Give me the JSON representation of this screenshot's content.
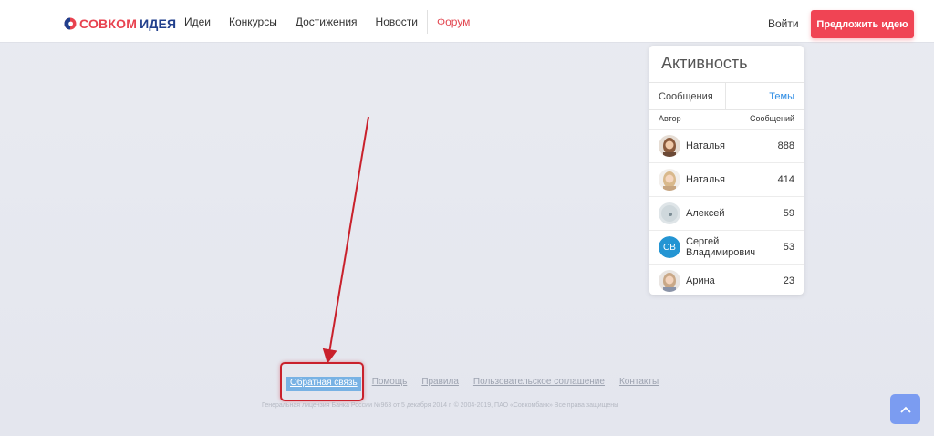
{
  "header": {
    "logo_part1": "СОВКОМ",
    "logo_part2": "ИДЕЯ",
    "nav": [
      {
        "label": "Идеи"
      },
      {
        "label": "Конкурсы"
      },
      {
        "label": "Достижения"
      },
      {
        "label": "Новости"
      },
      {
        "label": "Форум"
      }
    ],
    "login": "Войти",
    "suggest_button": "Предложить идею"
  },
  "activity": {
    "title": "Активность",
    "tabs": {
      "messages": "Сообщения",
      "topics": "Темы"
    },
    "columns": {
      "author": "Автор",
      "count": "Сообщений"
    },
    "rows": [
      {
        "name": "Наталья",
        "count": "888"
      },
      {
        "name": "Наталья",
        "count": "414"
      },
      {
        "name": "Алексей",
        "count": "59"
      },
      {
        "name": "Сергей Владимирович",
        "initials": "СВ",
        "count": "53"
      },
      {
        "name": "Арина",
        "count": "23"
      }
    ]
  },
  "footer": {
    "links": [
      "Обратная связь",
      "Помощь",
      "Правила",
      "Пользовательское соглашение",
      "Контакты"
    ],
    "copyright": "Генеральная лицензия Банка России №963 от 5 декабря 2014 г. © 2004-2019, ПАО «Совкомбанк» Все права защищены"
  },
  "colors": {
    "brand_red": "#f04454",
    "brand_blue": "#213f8c",
    "link_blue": "#2f8de4",
    "annotation_red": "#c9212c"
  },
  "icons": {
    "scroll_up": "chevron-up-icon",
    "logo_mark": "sovcom-logo-icon"
  }
}
